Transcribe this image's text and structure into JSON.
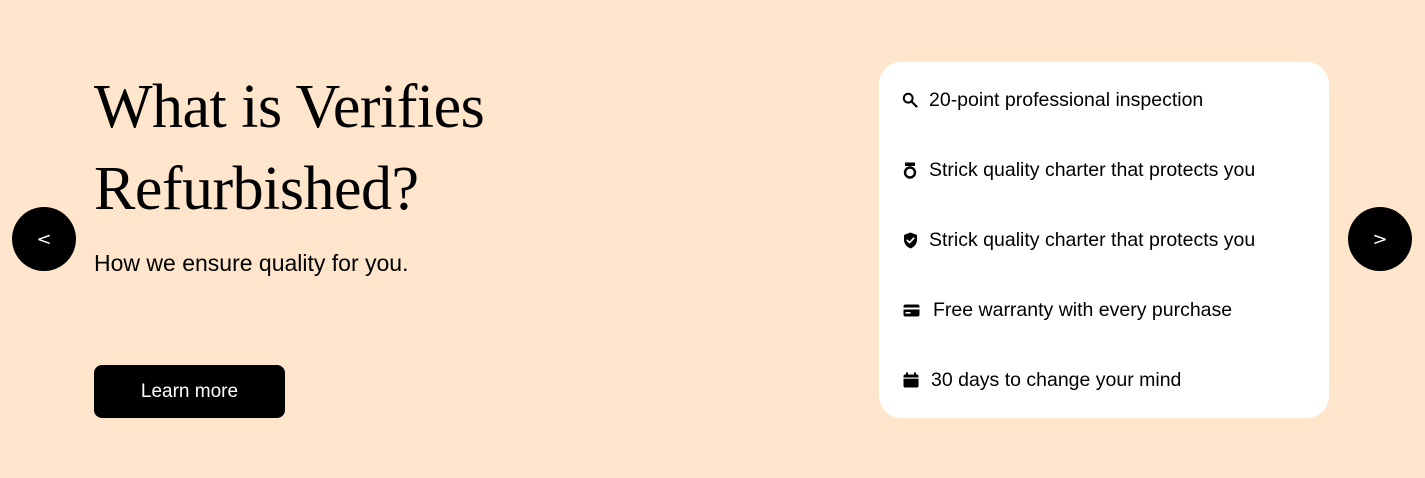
{
  "hero": {
    "title": "What is Verifies Refurbished?",
    "subtitle": "How we ensure quality for you.",
    "cta_label": "Learn more"
  },
  "carousel": {
    "prev_label": "<",
    "next_label": ">"
  },
  "features": [
    {
      "icon": "search-icon",
      "label": "20-point professional inspection"
    },
    {
      "icon": "medal-icon",
      "label": "Strick quality charter that protects you"
    },
    {
      "icon": "shield-check-icon",
      "label": "Strick quality charter that protects you"
    },
    {
      "icon": "credit-card-icon",
      "label": "Free warranty with every purchase"
    },
    {
      "icon": "calendar-icon",
      "label": "30 days to change your mind"
    }
  ],
  "colors": {
    "background": "#fee5cb",
    "card": "#ffffff",
    "accent": "#000000"
  }
}
